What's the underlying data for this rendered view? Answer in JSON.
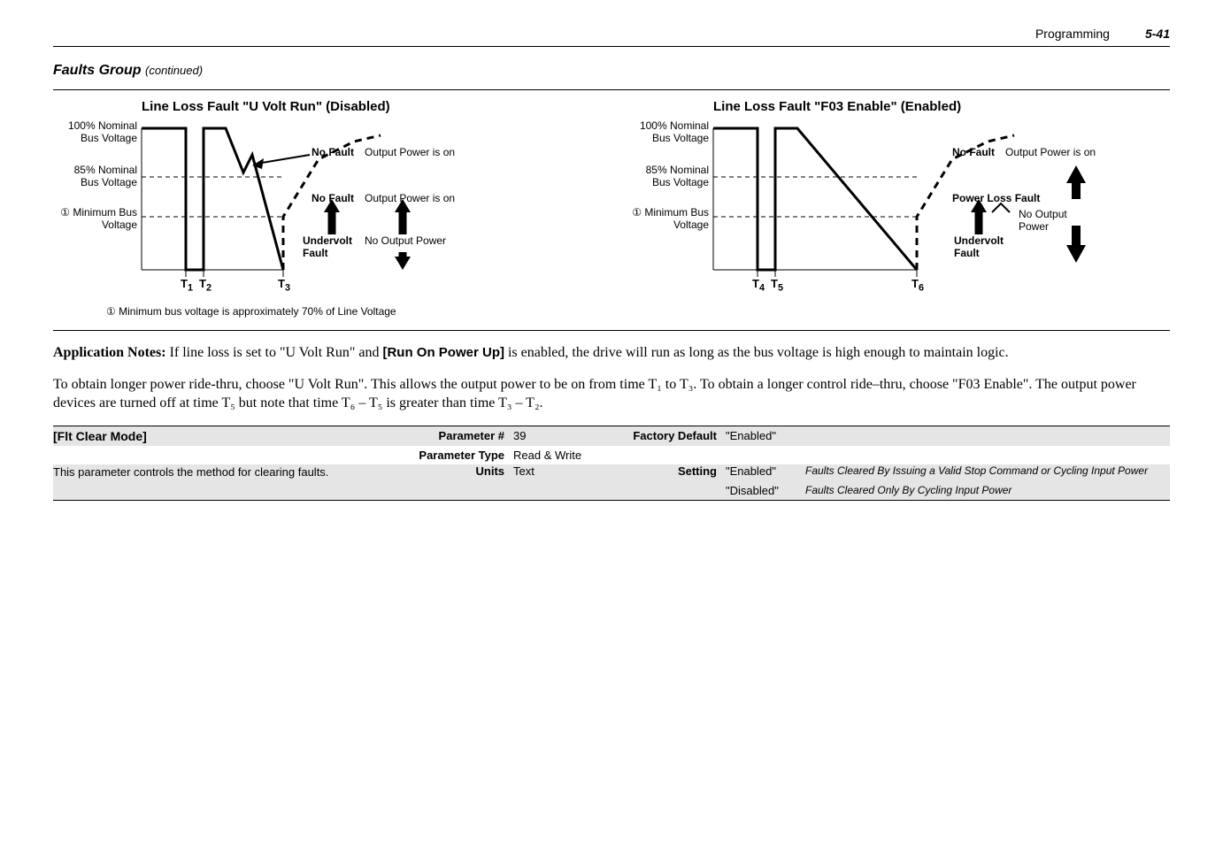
{
  "header": {
    "section": "Programming",
    "page_number": "5-41"
  },
  "group": {
    "title": "Faults Group",
    "suffix": "(continued)"
  },
  "chart_data": [
    {
      "type": "line",
      "title": "Line Loss Fault \"U Volt Run\" (Disabled)",
      "y_labels": [
        {
          "text": "100% Nominal\nBus Voltage",
          "level": "top"
        },
        {
          "text": "85% Nominal\nBus Voltage",
          "level": "mid"
        },
        {
          "text": "Minimum Bus\nVoltage",
          "level": "low",
          "circle": "①"
        }
      ],
      "x_ticks": [
        "T₁",
        "T₂",
        "T₃"
      ],
      "annotations": [
        {
          "text": "No Fault",
          "note": "Output Power is on",
          "near": "T₂-dip",
          "bold": true
        },
        {
          "text": "No Fault",
          "note": "Output Power is on",
          "near": "T₃-mid",
          "bold": true
        },
        {
          "text": "Undervolt Fault",
          "note": "No Output Power",
          "near": "T₃-low",
          "bold": true
        }
      ]
    },
    {
      "type": "line",
      "title": "Line Loss Fault \"F03 Enable\"  (Enabled)",
      "y_labels": [
        {
          "text": "100% Nominal\nBus Voltage",
          "level": "top"
        },
        {
          "text": "85% Nominal\nBus Voltage",
          "level": "mid"
        },
        {
          "text": "Minimum Bus\nVoltage",
          "level": "low",
          "circle": "①"
        }
      ],
      "x_ticks": [
        "T₄",
        "T₅",
        "T₆"
      ],
      "annotations": [
        {
          "text": "No Fault",
          "note": "Output Power is on",
          "near": "T₅-dip",
          "bold": true
        },
        {
          "text": "Power Loss Fault",
          "note": "No Output Power",
          "near": "T₆-mid",
          "bold": true
        },
        {
          "text": "Undervolt Fault",
          "near": "T₆-low",
          "bold": true
        }
      ]
    }
  ],
  "footnote": {
    "marker": "①",
    "text": "Minimum bus voltage is approximately 70% of Line Voltage"
  },
  "body": {
    "p1_prefix": " Application Notes:",
    "p1_rest": "   If line loss is set to \"U Volt Run\" and ",
    "p1_param": "[Run On Power Up]",
    "p1_end": " is enabled, the drive will run as long as the bus voltage is high enough to maintain logic.",
    "p2": "To obtain longer power ride-thru, choose \"U Volt Run\". This allows the output power to be on from time T₁ to T₃. To obtain a longer control ride–thru, choose \"F03 Enable\". The output power devices are turned off at time T₅ but note that time T₆ – T₅ is greater than time T₃ – T₂."
  },
  "param_table": {
    "name": "[Flt  Clear Mode]",
    "desc": "This parameter controls the method for clearing faults.",
    "labels": {
      "pnum": "Parameter #",
      "ptype": "Parameter Type",
      "units": "Units",
      "fdef": "Factory Default",
      "setting": "Setting"
    },
    "values": {
      "pnum": "39",
      "ptype": "Read & Write",
      "units": "Text",
      "fdef": "\"Enabled\""
    },
    "settings": [
      {
        "val": "\"Enabled\"",
        "note": "Faults Cleared By Issuing a Valid Stop Command or Cycling Input Power"
      },
      {
        "val": "\"Disabled\"",
        "note": "Faults Cleared Only By Cycling Input Power"
      }
    ]
  }
}
